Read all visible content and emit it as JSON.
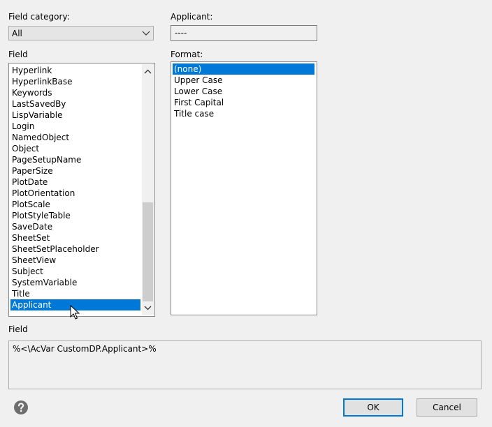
{
  "labels": {
    "field_category": "Field category:",
    "applicant": "Applicant:",
    "field": "Field",
    "format": "Format:",
    "field_expression": "Field"
  },
  "field_category": {
    "value": "All",
    "icon": "chevron-down-icon"
  },
  "applicant": {
    "value": "----"
  },
  "field_list": {
    "items": [
      "Hyperlink",
      "HyperlinkBase",
      "Keywords",
      "LastSavedBy",
      "LispVariable",
      "Login",
      "NamedObject",
      "Object",
      "PageSetupName",
      "PaperSize",
      "PlotDate",
      "PlotOrientation",
      "PlotScale",
      "PlotStyleTable",
      "SaveDate",
      "SheetSet",
      "SheetSetPlaceholder",
      "SheetView",
      "Subject",
      "SystemVariable",
      "Title",
      "Applicant"
    ],
    "selected": "Applicant"
  },
  "format_list": {
    "items": [
      "(none)",
      "Upper Case",
      "Lower Case",
      "First Capital",
      "Title case"
    ],
    "selected": "(none)"
  },
  "field_expression": {
    "value": "%<\\AcVar CustomDP.Applicant>%"
  },
  "buttons": {
    "ok": "OK",
    "cancel": "Cancel"
  },
  "icons": {
    "help": "help-icon",
    "cursor": "mouse-pointer-icon"
  },
  "colors": {
    "selection": "#0078d7",
    "default_button_border": "#0078d7",
    "background": "#f0f0f0"
  }
}
